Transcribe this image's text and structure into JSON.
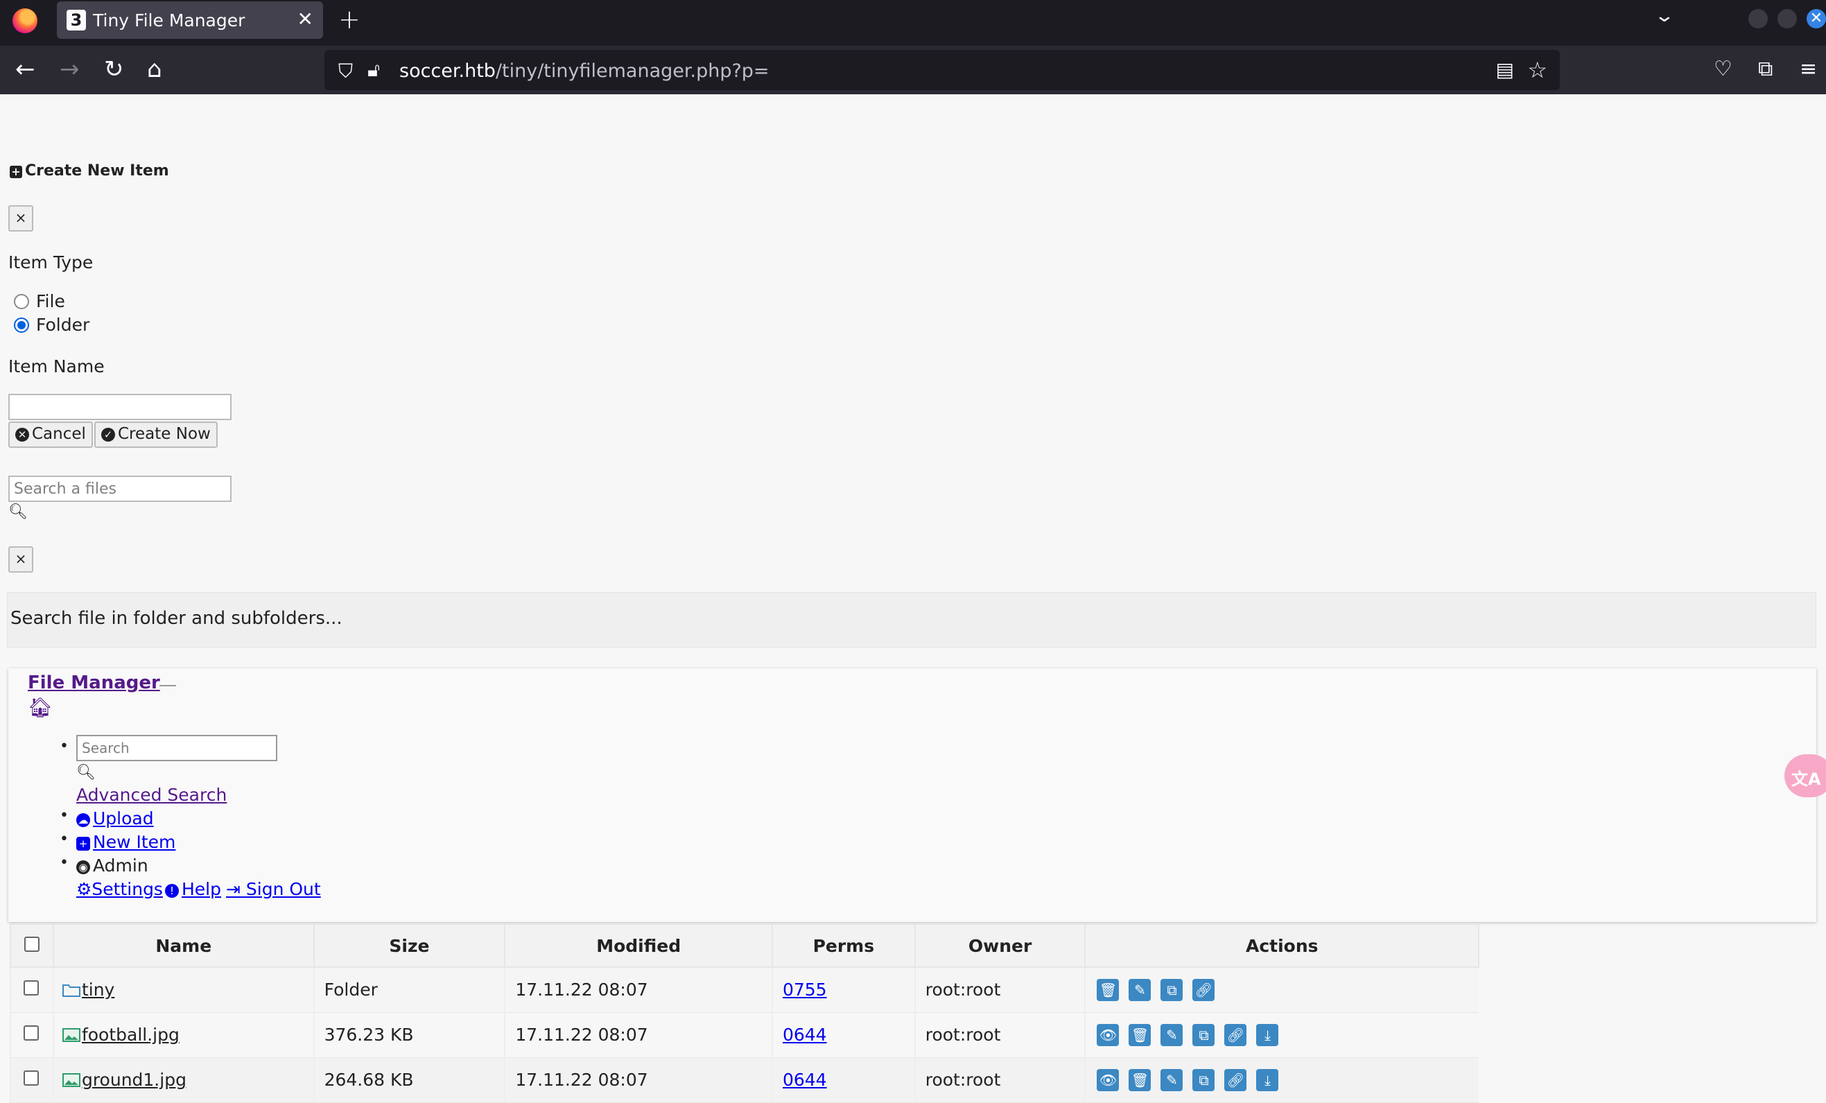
{
  "browser": {
    "tab_title": "Tiny File Manager",
    "tab_favicon": "3",
    "url_host": "soccer.htb",
    "url_path": "/tiny/tinyfilemanager.php?p="
  },
  "create_panel": {
    "title": "Create New Item",
    "close_label": "×",
    "item_type_label": "Item Type",
    "options": [
      {
        "label": "File",
        "selected": false
      },
      {
        "label": "Folder",
        "selected": true
      }
    ],
    "item_name_label": "Item Name",
    "item_name_value": "",
    "cancel_label": "Cancel",
    "create_label": "Create Now"
  },
  "search_panel": {
    "placeholder": "Search a files",
    "close_label": "×",
    "hint": "Search file in folder and subfolders..."
  },
  "file_manager": {
    "title": "File Manager",
    "search_placeholder": "Search",
    "advanced_search": "Advanced Search",
    "upload": "Upload",
    "new_item": "New Item",
    "user": "Admin",
    "settings": "Settings",
    "help": "Help",
    "sign_out": "Sign Out"
  },
  "table": {
    "headers": [
      "Name",
      "Size",
      "Modified",
      "Perms",
      "Owner",
      "Actions"
    ],
    "rows": [
      {
        "name": "tiny",
        "type": "folder",
        "size": "Folder",
        "modified": "17.11.22 08:07",
        "perms": "0755",
        "owner": "root:root"
      },
      {
        "name": "football.jpg",
        "type": "image",
        "size": "376.23 KB",
        "modified": "17.11.22 08:07",
        "perms": "0644",
        "owner": "root:root"
      },
      {
        "name": "ground1.jpg",
        "type": "image",
        "size": "264.68 KB",
        "modified": "17.11.22 08:07",
        "perms": "0644",
        "owner": "root:root"
      }
    ]
  },
  "colors": {
    "action_blue": "#3b88c3",
    "link_blue": "#0000ee",
    "visited_purple": "#551a8b"
  }
}
